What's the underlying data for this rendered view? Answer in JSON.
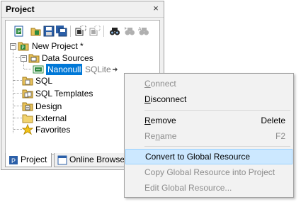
{
  "panel": {
    "title": "Project",
    "close_glyph": "×"
  },
  "toolbar": {
    "buttons": [
      {
        "name": "new-project-icon"
      },
      {
        "name": "open-project-icon"
      },
      {
        "name": "save-project-icon"
      },
      {
        "name": "save-all-icon"
      },
      {
        "name": "add-data-source-icon"
      },
      {
        "name": "add-folder-icon"
      },
      {
        "name": "find-icon"
      },
      {
        "name": "find-next-icon"
      },
      {
        "name": "replace-icon"
      }
    ]
  },
  "tree": {
    "project": "New Project *",
    "data_sources": "Data Sources",
    "selected_name": "Nanonull",
    "selected_type": "SQLite",
    "sql": "SQL",
    "sql_templates": "SQL Templates",
    "design": "Design",
    "external": "External",
    "favorites": "Favorites"
  },
  "tabs": [
    {
      "label": "Project",
      "active": true
    },
    {
      "label": "Online Browser",
      "active": false
    }
  ],
  "menu": {
    "connect": {
      "pre": "",
      "acc": "C",
      "post": "onnect",
      "disabled": true
    },
    "disconnect": {
      "pre": "",
      "acc": "D",
      "post": "isconnect",
      "disabled": false
    },
    "remove": {
      "pre": "",
      "acc": "R",
      "post": "emove",
      "shortcut": "Delete",
      "disabled": false
    },
    "rename": {
      "pre": "Re",
      "acc": "n",
      "post": "ame",
      "shortcut": "F2",
      "disabled": true
    },
    "convert": {
      "label": "Convert to Global Resource",
      "highlighted": true
    },
    "copy": {
      "label": "Copy Global Resource into Project",
      "disabled": true
    },
    "edit": {
      "label": "Edit Global Resource...",
      "disabled": true
    }
  },
  "colors": {
    "selection": "#0078d7",
    "menu_highlight": "#cce8ff",
    "folder": "#e8c25a"
  }
}
